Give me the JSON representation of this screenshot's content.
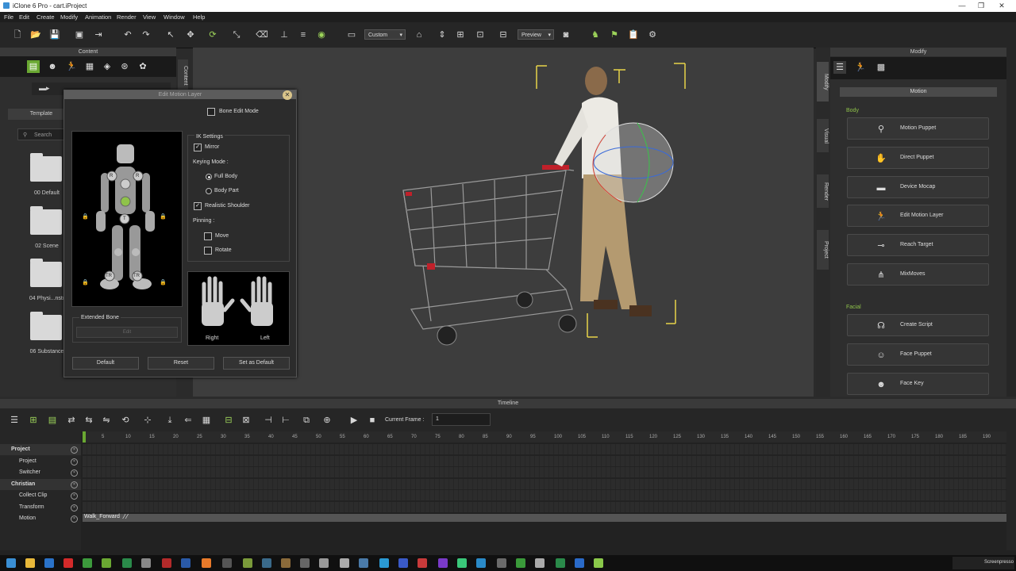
{
  "window": {
    "title": "iClone 6 Pro - cart.iProject"
  },
  "menu": [
    "File",
    "Edit",
    "Create",
    "Modify",
    "Animation",
    "Render",
    "View",
    "Window",
    "Help"
  ],
  "toolbar": {
    "camera_select": "Custom",
    "preview_select": "Preview"
  },
  "content_panel": {
    "title": "Content",
    "side_tab": "Content",
    "template_tab": "Template",
    "search_placeholder": "Search",
    "folders": [
      "00 Default",
      "02 Scene",
      "04 Physi...nstr",
      "06 Substance"
    ]
  },
  "dialog": {
    "title": "Edit Motion Layer",
    "bone_edit_mode": "Bone Edit Mode",
    "ik_settings": "IK Settings",
    "mirror": "Mirror",
    "keying_mode": "Keying Mode :",
    "full_body": "Full Body",
    "body_part": "Body Part",
    "realistic_shoulder": "Realistic Shoulder",
    "pinning": "Pinning :",
    "move": "Move",
    "rotate": "Rotate",
    "right": "Right",
    "left": "Left",
    "extended_bone": "Extended Bone",
    "edit": "Edit",
    "default_btn": "Default",
    "reset_btn": "Reset",
    "set_default_btn": "Set as Default",
    "joint_labels": {
      "r": "R",
      "t": "T",
      "tr": "TR"
    }
  },
  "modify_panel": {
    "title": "Modify",
    "side_tabs": [
      "Modify",
      "Visual",
      "Render",
      "Project"
    ],
    "motion_header": "Motion",
    "body_label": "Body",
    "body_buttons": [
      "Motion Puppet",
      "Direct Puppet",
      "Device Mocap",
      "Edit Motion Layer",
      "Reach Target",
      "MixMoves"
    ],
    "facial_label": "Facial",
    "facial_buttons": [
      "Create Script",
      "Face Puppet",
      "Face Key"
    ]
  },
  "timeline": {
    "title": "Timeline",
    "current_frame_label": "Current Frame :",
    "current_frame_value": "1",
    "ticks": [
      "5",
      "10",
      "15",
      "20",
      "25",
      "30",
      "35",
      "40",
      "45",
      "50",
      "55",
      "60",
      "65",
      "70",
      "75",
      "80",
      "85",
      "90",
      "95",
      "100",
      "105",
      "110",
      "115",
      "120",
      "125",
      "130",
      "135",
      "140",
      "145",
      "150",
      "155",
      "160",
      "165",
      "170",
      "175",
      "180",
      "185",
      "190"
    ],
    "tracks": [
      {
        "name": "Project",
        "header": true
      },
      {
        "name": "Project",
        "header": false
      },
      {
        "name": "Switcher",
        "header": false
      },
      {
        "name": "Christian",
        "header": true
      },
      {
        "name": "Collect Clip",
        "header": false
      },
      {
        "name": "Transform",
        "header": false
      },
      {
        "name": "Motion",
        "header": false
      }
    ],
    "motion_clip": "Walk_Forward"
  },
  "watermark": "Screenpresso",
  "colors": {
    "accent_green": "#8fc34a",
    "dialog_title": "#5c5c5c"
  }
}
